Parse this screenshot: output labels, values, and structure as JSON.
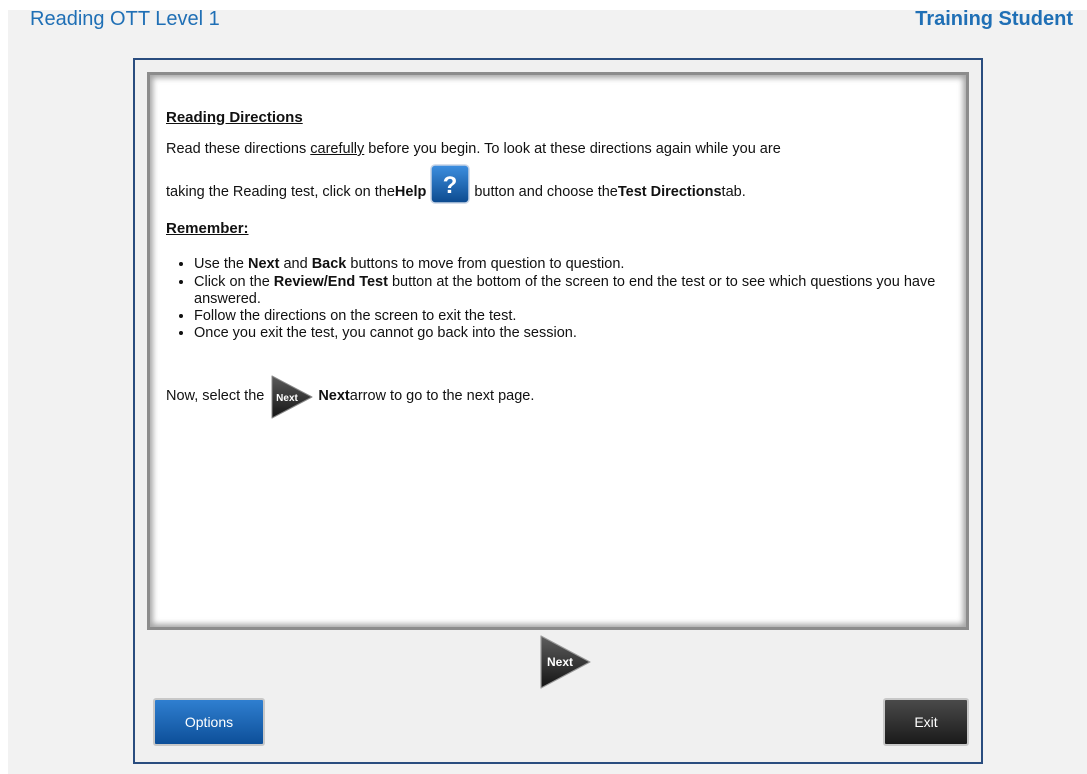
{
  "header": {
    "app_title": "Reading OTT Level 1",
    "user_name": "Training Student"
  },
  "directions": {
    "heading": "Reading Directions",
    "intro_before": "Read these directions ",
    "intro_emphasis": "carefully",
    "intro_after": " before you begin. To look at these directions again while you are",
    "help_line_before": "taking the Reading test, click on the ",
    "help_word": "Help",
    "help_line_middle": " button and choose the ",
    "test_directions_word": "Test Directions",
    "help_line_after": " tab.",
    "help_icon_glyph": "?",
    "remember_heading": "Remember:",
    "rules": [
      {
        "before": "Use the ",
        "b1": "Next",
        "mid": " and ",
        "b2": "Back",
        "after": " buttons to move from question to question."
      },
      {
        "before": "Click on the ",
        "b1": "Review/End Test",
        "mid": " button at the bottom of the screen to end the test or to see which questions you have answered.",
        "b2": "",
        "after": ""
      },
      {
        "before": "Follow the directions on the screen to exit the test.",
        "b1": "",
        "mid": "",
        "b2": "",
        "after": ""
      },
      {
        "before": "Once you exit the test, you cannot go back into the session.",
        "b1": "",
        "mid": "",
        "b2": "",
        "after": ""
      }
    ],
    "next_line_before": "Now, select the ",
    "next_word": "Next",
    "next_line_after": " arrow to go to the next page.",
    "inline_next_label": "Next"
  },
  "navigation": {
    "next_label": "Next"
  },
  "footer": {
    "options_label": "Options",
    "exit_label": "Exit"
  },
  "colors": {
    "title_blue": "#1f6fb5",
    "frame_border": "#2a4d7f",
    "options_blue": "#0d4f99",
    "exit_dark": "#1a1a1a"
  }
}
